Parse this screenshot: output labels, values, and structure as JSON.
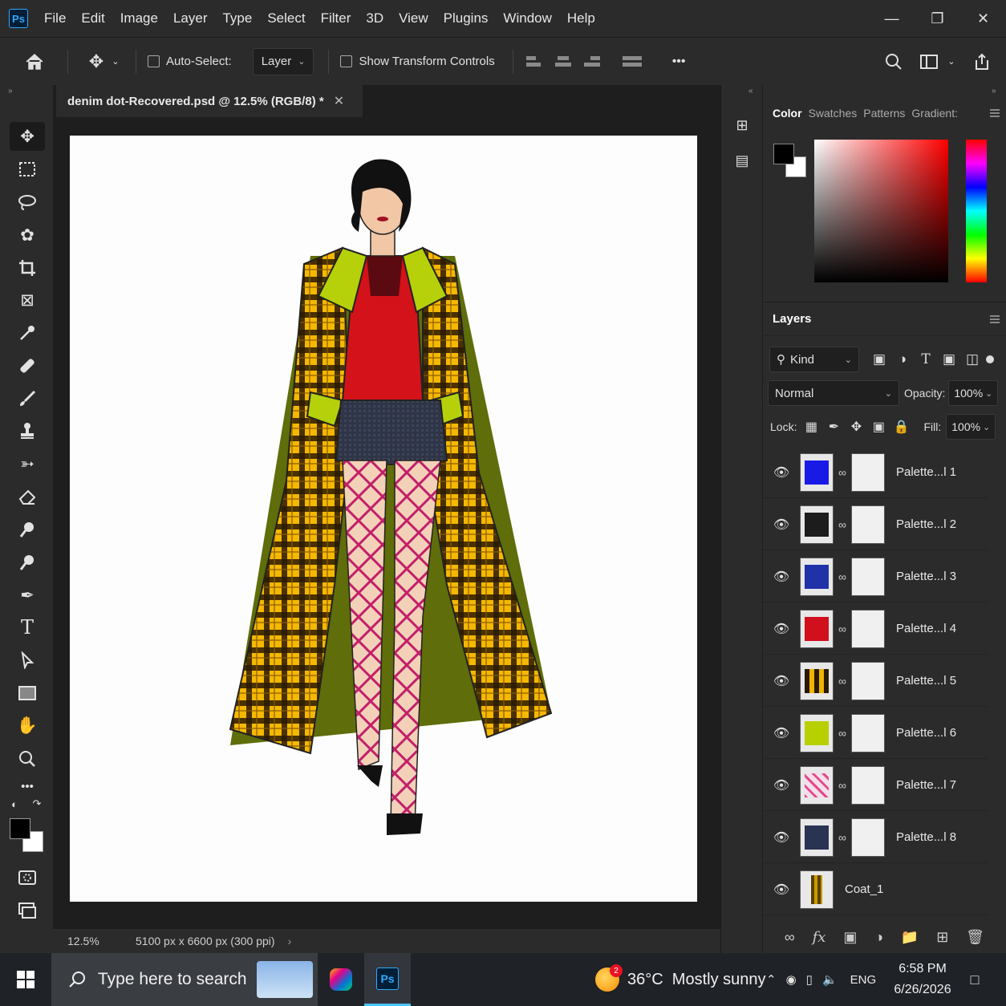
{
  "menubar": {
    "app_badge": "Ps",
    "items": [
      "File",
      "Edit",
      "Image",
      "Layer",
      "Type",
      "Select",
      "Filter",
      "3D",
      "View",
      "Plugins",
      "Window",
      "Help"
    ]
  },
  "options": {
    "auto_select_label": "Auto-Select:",
    "auto_select_target": "Layer",
    "show_transform_label": "Show Transform Controls",
    "more": "•••"
  },
  "document": {
    "tab_title": "denim dot-Recovered.psd @ 12.5% (RGB/8) *",
    "zoom": "12.5%",
    "doc_info": "5100 px x 6600 px (300 ppi)"
  },
  "color_panel": {
    "tabs": [
      "Color",
      "Swatches",
      "Patterns",
      "Gradient:"
    ],
    "foreground": "#000000",
    "background": "#ffffff"
  },
  "layers_panel": {
    "title": "Layers",
    "filter_kind": "Kind",
    "blend_mode": "Normal",
    "opacity_label": "Opacity:",
    "opacity_value": "100%",
    "lock_label": "Lock:",
    "fill_label": "Fill:",
    "fill_value": "100%",
    "layers": [
      {
        "name": "Palette...l 1",
        "color": "#1a1ae6",
        "has_mask": true
      },
      {
        "name": "Palette...l 2",
        "color": "#1c1c1c",
        "has_mask": true
      },
      {
        "name": "Palette...l 3",
        "color": "#1f32a8",
        "has_mask": true
      },
      {
        "name": "Palette...l 4",
        "color": "#d0101c",
        "has_mask": true
      },
      {
        "name": "Palette...l 5",
        "color": "#f0b400",
        "has_mask": true
      },
      {
        "name": "Palette...l 6",
        "color": "#b8d000",
        "has_mask": true
      },
      {
        "name": "Palette...l 7",
        "color": "#e24a8e",
        "has_mask": true
      },
      {
        "name": "Palette...l 8",
        "color": "#2a3352",
        "has_mask": true
      },
      {
        "name": "Coat_1",
        "color": "#c79b00",
        "has_mask": false
      }
    ]
  },
  "taskbar": {
    "search_placeholder": "Type here to search",
    "weather_badge": "2",
    "weather": "36°C  Mostly sunny",
    "language": "ENG",
    "time": "6:58 PM",
    "date": "6/26/2026"
  }
}
